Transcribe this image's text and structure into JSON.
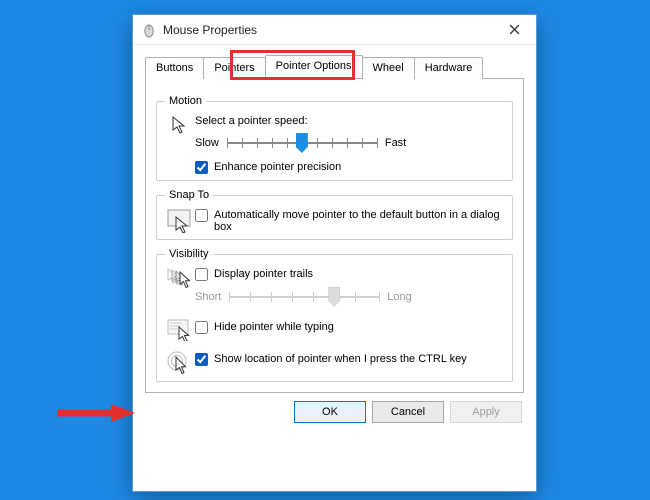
{
  "window": {
    "title": "Mouse Properties"
  },
  "tabs": {
    "items": [
      "Buttons",
      "Pointers",
      "Pointer Options",
      "Wheel",
      "Hardware"
    ],
    "selectedIndex": 2
  },
  "motion": {
    "legend": "Motion",
    "label": "Select a pointer speed:",
    "slow": "Slow",
    "fast": "Fast",
    "speed_value": 5,
    "speed_min": 0,
    "speed_max": 10,
    "enhance_label": "Enhance pointer precision",
    "enhance_checked": true
  },
  "snap": {
    "legend": "Snap To",
    "label": "Automatically move pointer to the default button in a dialog box",
    "checked": false
  },
  "visibility": {
    "legend": "Visibility",
    "trails_label": "Display pointer trails",
    "trails_checked": false,
    "short": "Short",
    "long": "Long",
    "trails_value": 7,
    "trails_min": 0,
    "trails_max": 10,
    "hide_label": "Hide pointer while typing",
    "hide_checked": false,
    "ctrl_label": "Show location of pointer when I press the CTRL key",
    "ctrl_checked": true
  },
  "buttons": {
    "ok": "OK",
    "cancel": "Cancel",
    "apply": "Apply"
  },
  "icons": {
    "app": "mouse-icon",
    "close": "close-icon",
    "cursor": "cursor-icon",
    "snap": "snap-to-icon",
    "trails": "pointer-trails-icon",
    "hide": "hide-pointer-icon",
    "ctrl": "ctrl-locator-icon"
  }
}
